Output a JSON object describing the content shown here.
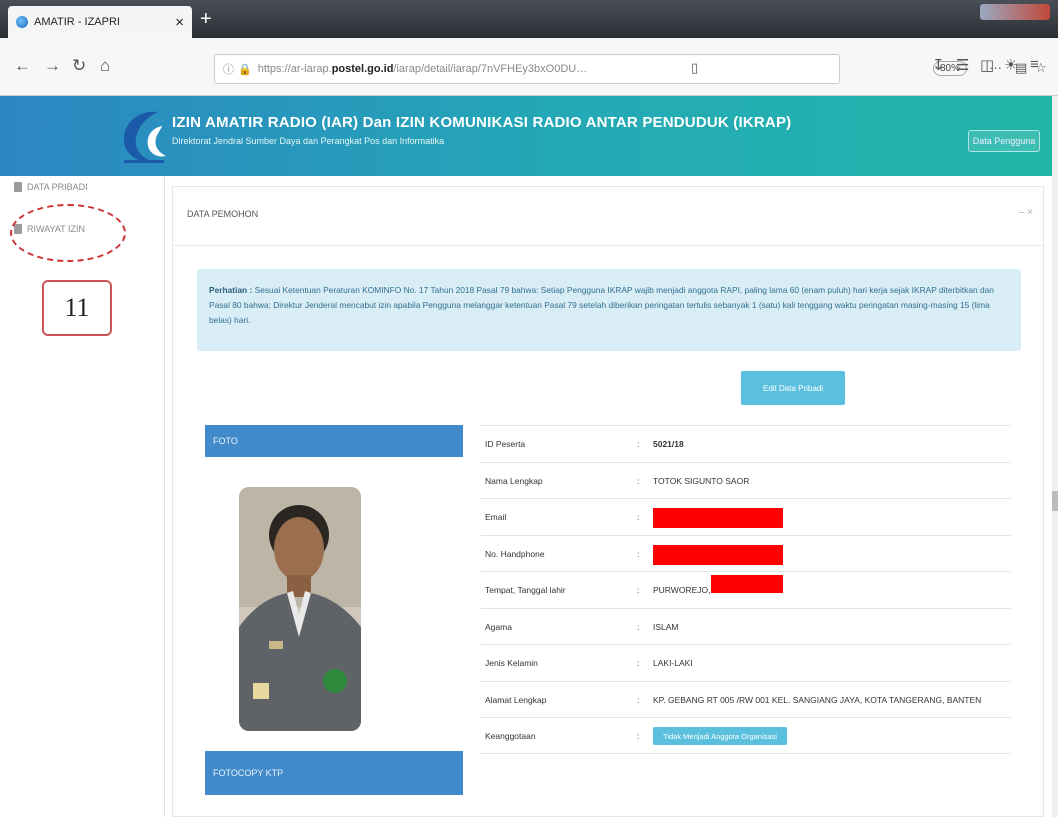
{
  "browser": {
    "tab_title": "AMATIR - IZAPRI",
    "tab_close": "×",
    "new_tab": "+",
    "url_prefix": "https://ar-iarap.",
    "url_host": "postel.go.id",
    "url_rest": "/iarap/detail/iarap/7nVFHEy3bxO0DU…",
    "zoom": "80%",
    "more": "···"
  },
  "app": {
    "title": "IZIN AMATIR RADIO (IAR) Dan IZIN KOMUNIKASI RADIO ANTAR PENDUDUK (IKRAP)",
    "subtitle": "Direktorat Jendral Sumber Daya dan Perangkat Pos dan Informatika",
    "header_button": "Data Pengguna"
  },
  "sidebar": {
    "items": [
      {
        "label": "DATA PRIBADI"
      },
      {
        "label": "RIWAYAT IZIN"
      }
    ],
    "annotation_number": "11"
  },
  "panel": {
    "title": "DATA PEMOHON",
    "controls": "–  ×"
  },
  "alert": {
    "label": "Perhatian :",
    "text": "Sesuai Ketentuan Peraturan KOMINFO No. 17 Tahun 2018 Pasal 79 bahwa: Setiap Pengguna IKRAP wajib menjadi anggota RAPI, paling lama 60 (enam puluh) hari kerja sejak IKRAP diterbitkan dan Pasal 80 bahwa: Direktur Jenderal mencabut izin apabila Pengguna melanggar ketentuan Pasal 79 setelah diberikan peringatan tertulis sebanyak 1 (satu) kali tenggang waktu peringatan masing-masing 15 (lima belas) hari."
  },
  "edit_button": "Edit Data Pribadi",
  "photo_header": "FOTO",
  "ktp_header": "FOTOCOPY KTP",
  "details": [
    {
      "label": "ID Peserta",
      "value": "5021/18"
    },
    {
      "label": "Nama Lengkap",
      "value": "TOTOK SIGUNTO SAOR"
    },
    {
      "label": "Email",
      "value": "",
      "redacted": true
    },
    {
      "label": "No. Handphone",
      "value": "",
      "redacted": true
    },
    {
      "label": "Tempat, Tanggal lahir",
      "value": "PURWOREJO,",
      "redacted_partial": true
    },
    {
      "label": "Agama",
      "value": "ISLAM"
    },
    {
      "label": "Jenis Kelamin",
      "value": "LAKI-LAKI"
    },
    {
      "label": "Alamat Lengkap",
      "value": "KP. GEBANG RT 005 /RW 001 KEL. SANGIANG JAYA, KOTA TANGERANG, BANTEN"
    },
    {
      "label": "Keanggotaan",
      "value": "",
      "chip": "Tidak Menjadi Anggota Organisasi"
    }
  ],
  "colors": {
    "header_start": "#2c86c2",
    "header_end": "#22b6a8",
    "info_button": "#5bc0de",
    "primary": "#428bca",
    "alert_bg": "#d9edf7",
    "redaction": "#ff0000"
  }
}
